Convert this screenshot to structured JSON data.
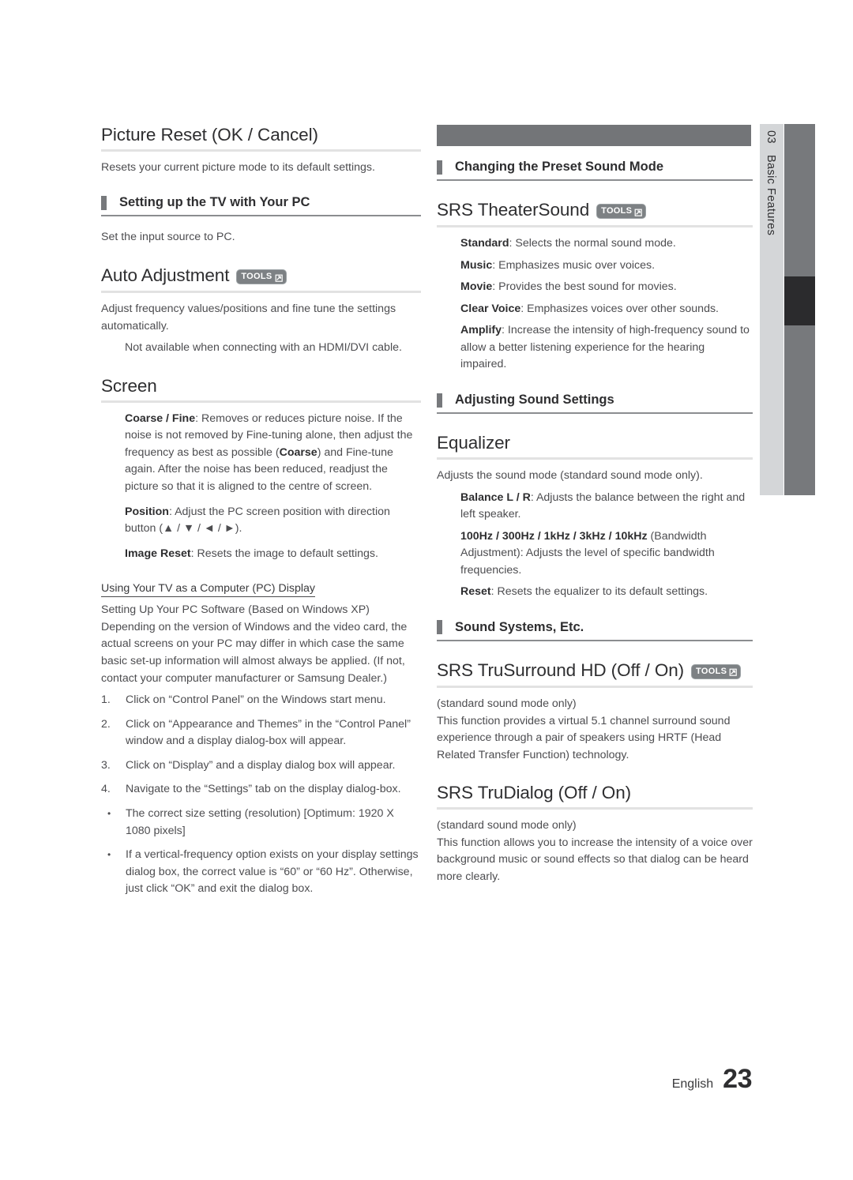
{
  "document": {
    "side_tab": {
      "number": "03",
      "title": "Basic Features"
    },
    "footer": {
      "language": "English",
      "page_number": "23"
    },
    "tools_badge_label": "TOOLS"
  },
  "left_column": {
    "picture_reset": {
      "heading": "Picture Reset (OK / Cancel)",
      "body": "Resets your current picture mode to its default settings."
    },
    "setting_up_pc": {
      "heading": "Setting up the TV with Your PC",
      "body": "Set the input source to PC."
    },
    "auto_adjustment": {
      "heading": "Auto Adjustment",
      "body": "Adjust frequency values/positions and fine tune the settings automatically.",
      "note": "Not available when connecting with an HDMI/DVI cable."
    },
    "screen": {
      "heading": "Screen",
      "items": [
        {
          "term": "Coarse / Fine",
          "text": ": Removes or reduces picture noise. If the noise is not removed by Fine-tuning alone, then adjust the frequency as best as possible (Coarse) and Fine-tune again. After the noise has been reduced, readjust the picture so that it is aligned to the centre of screen."
        },
        {
          "term": "Position",
          "text": ": Adjust the PC screen position with direction button (▲ / ▼ / ◄ / ►)."
        },
        {
          "term": "Image Reset",
          "text": ": Resets the image to default settings."
        }
      ]
    },
    "pc_display": {
      "heading": "Using Your TV as a Computer (PC) Display",
      "subheading": "Setting Up Your PC Software (Based on Windows XP)",
      "intro": "Depending on the version of Windows and the video card, the actual screens on your PC may differ in which case the same basic set-up information will almost always be applied. (If not, contact your computer manufacturer or Samsung Dealer.)",
      "steps": [
        {
          "num": "1.",
          "text": "Click on “Control Panel” on the Windows start menu."
        },
        {
          "num": "2.",
          "text": "Click on “Appearance and Themes” in the “Control Panel” window and a display dialog-box will appear."
        },
        {
          "num": "3.",
          "text": "Click on “Display” and a display dialog box will appear."
        },
        {
          "num": "4.",
          "text": "Navigate to the “Settings” tab on the display dialog-box."
        }
      ],
      "bullets": [
        {
          "mark": "•",
          "text": "The correct size setting (resolution) [Optimum: 1920 X 1080 pixels]"
        },
        {
          "mark": "•",
          "text": "If a vertical-frequency option exists on your display settings dialog box, the correct value is “60” or “60 Hz”. Otherwise, just click “OK” and exit the dialog box."
        }
      ]
    }
  },
  "right_column": {
    "preset_sound_mode": {
      "heading": "Changing the Preset Sound Mode"
    },
    "srs_theatersound": {
      "heading": "SRS TheaterSound",
      "has_tools": true,
      "items": [
        {
          "term": "Standard",
          "text": ": Selects the normal sound mode."
        },
        {
          "term": "Music",
          "text": ": Emphasizes music over voices."
        },
        {
          "term": "Movie",
          "text": ": Provides the best sound for movies."
        },
        {
          "term": "Clear Voice",
          "text": ": Emphasizes voices over other sounds."
        },
        {
          "term": "Amplify",
          "text": ": Increase the intensity of high-frequency sound to allow a better listening experience for the hearing impaired."
        }
      ]
    },
    "adjusting_sound": {
      "heading": "Adjusting Sound Settings"
    },
    "equalizer": {
      "heading": "Equalizer",
      "body": "Adjusts the sound mode (standard sound mode only).",
      "items": [
        {
          "term": "Balance L / R",
          "text": ": Adjusts the balance between the right and left speaker."
        },
        {
          "term": "100Hz / 300Hz / 1kHz / 3kHz / 10kHz",
          "text": " (Bandwidth Adjustment): Adjusts the level of specific bandwidth frequencies."
        },
        {
          "term": "Reset",
          "text": ": Resets the equalizer to its default settings."
        }
      ]
    },
    "sound_systems": {
      "heading": "Sound Systems, Etc."
    },
    "srs_trusurround": {
      "heading": "SRS TruSurround HD (Off / On)",
      "has_tools": true,
      "note": "(standard sound mode only)",
      "body": "This function provides a virtual 5.1 channel surround sound experience through a pair of speakers using HRTF (Head Related Transfer Function) technology."
    },
    "srs_trudialog": {
      "heading": "SRS TruDialog (Off / On)",
      "has_tools": false,
      "note": "(standard sound mode only)",
      "body": "This function allows you to increase the intensity of a voice over background music or sound effects so that dialog can be heard more clearly."
    }
  }
}
